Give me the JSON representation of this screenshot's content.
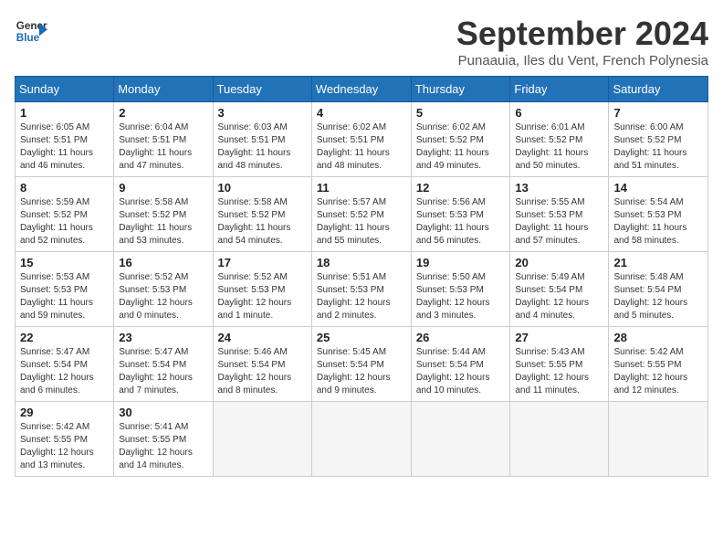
{
  "logo": {
    "line1": "General",
    "line2": "Blue"
  },
  "title": "September 2024",
  "subtitle": "Punaauia, Iles du Vent, French Polynesia",
  "days_of_week": [
    "Sunday",
    "Monday",
    "Tuesday",
    "Wednesday",
    "Thursday",
    "Friday",
    "Saturday"
  ],
  "weeks": [
    [
      {
        "day": "1",
        "detail": "Sunrise: 6:05 AM\nSunset: 5:51 PM\nDaylight: 11 hours\nand 46 minutes."
      },
      {
        "day": "2",
        "detail": "Sunrise: 6:04 AM\nSunset: 5:51 PM\nDaylight: 11 hours\nand 47 minutes."
      },
      {
        "day": "3",
        "detail": "Sunrise: 6:03 AM\nSunset: 5:51 PM\nDaylight: 11 hours\nand 48 minutes."
      },
      {
        "day": "4",
        "detail": "Sunrise: 6:02 AM\nSunset: 5:51 PM\nDaylight: 11 hours\nand 48 minutes."
      },
      {
        "day": "5",
        "detail": "Sunrise: 6:02 AM\nSunset: 5:52 PM\nDaylight: 11 hours\nand 49 minutes."
      },
      {
        "day": "6",
        "detail": "Sunrise: 6:01 AM\nSunset: 5:52 PM\nDaylight: 11 hours\nand 50 minutes."
      },
      {
        "day": "7",
        "detail": "Sunrise: 6:00 AM\nSunset: 5:52 PM\nDaylight: 11 hours\nand 51 minutes."
      }
    ],
    [
      {
        "day": "8",
        "detail": "Sunrise: 5:59 AM\nSunset: 5:52 PM\nDaylight: 11 hours\nand 52 minutes."
      },
      {
        "day": "9",
        "detail": "Sunrise: 5:58 AM\nSunset: 5:52 PM\nDaylight: 11 hours\nand 53 minutes."
      },
      {
        "day": "10",
        "detail": "Sunrise: 5:58 AM\nSunset: 5:52 PM\nDaylight: 11 hours\nand 54 minutes."
      },
      {
        "day": "11",
        "detail": "Sunrise: 5:57 AM\nSunset: 5:52 PM\nDaylight: 11 hours\nand 55 minutes."
      },
      {
        "day": "12",
        "detail": "Sunrise: 5:56 AM\nSunset: 5:53 PM\nDaylight: 11 hours\nand 56 minutes."
      },
      {
        "day": "13",
        "detail": "Sunrise: 5:55 AM\nSunset: 5:53 PM\nDaylight: 11 hours\nand 57 minutes."
      },
      {
        "day": "14",
        "detail": "Sunrise: 5:54 AM\nSunset: 5:53 PM\nDaylight: 11 hours\nand 58 minutes."
      }
    ],
    [
      {
        "day": "15",
        "detail": "Sunrise: 5:53 AM\nSunset: 5:53 PM\nDaylight: 11 hours\nand 59 minutes."
      },
      {
        "day": "16",
        "detail": "Sunrise: 5:52 AM\nSunset: 5:53 PM\nDaylight: 12 hours\nand 0 minutes."
      },
      {
        "day": "17",
        "detail": "Sunrise: 5:52 AM\nSunset: 5:53 PM\nDaylight: 12 hours\nand 1 minute."
      },
      {
        "day": "18",
        "detail": "Sunrise: 5:51 AM\nSunset: 5:53 PM\nDaylight: 12 hours\nand 2 minutes."
      },
      {
        "day": "19",
        "detail": "Sunrise: 5:50 AM\nSunset: 5:53 PM\nDaylight: 12 hours\nand 3 minutes."
      },
      {
        "day": "20",
        "detail": "Sunrise: 5:49 AM\nSunset: 5:54 PM\nDaylight: 12 hours\nand 4 minutes."
      },
      {
        "day": "21",
        "detail": "Sunrise: 5:48 AM\nSunset: 5:54 PM\nDaylight: 12 hours\nand 5 minutes."
      }
    ],
    [
      {
        "day": "22",
        "detail": "Sunrise: 5:47 AM\nSunset: 5:54 PM\nDaylight: 12 hours\nand 6 minutes."
      },
      {
        "day": "23",
        "detail": "Sunrise: 5:47 AM\nSunset: 5:54 PM\nDaylight: 12 hours\nand 7 minutes."
      },
      {
        "day": "24",
        "detail": "Sunrise: 5:46 AM\nSunset: 5:54 PM\nDaylight: 12 hours\nand 8 minutes."
      },
      {
        "day": "25",
        "detail": "Sunrise: 5:45 AM\nSunset: 5:54 PM\nDaylight: 12 hours\nand 9 minutes."
      },
      {
        "day": "26",
        "detail": "Sunrise: 5:44 AM\nSunset: 5:54 PM\nDaylight: 12 hours\nand 10 minutes."
      },
      {
        "day": "27",
        "detail": "Sunrise: 5:43 AM\nSunset: 5:55 PM\nDaylight: 12 hours\nand 11 minutes."
      },
      {
        "day": "28",
        "detail": "Sunrise: 5:42 AM\nSunset: 5:55 PM\nDaylight: 12 hours\nand 12 minutes."
      }
    ],
    [
      {
        "day": "29",
        "detail": "Sunrise: 5:42 AM\nSunset: 5:55 PM\nDaylight: 12 hours\nand 13 minutes."
      },
      {
        "day": "30",
        "detail": "Sunrise: 5:41 AM\nSunset: 5:55 PM\nDaylight: 12 hours\nand 14 minutes."
      },
      {
        "day": "",
        "detail": ""
      },
      {
        "day": "",
        "detail": ""
      },
      {
        "day": "",
        "detail": ""
      },
      {
        "day": "",
        "detail": ""
      },
      {
        "day": "",
        "detail": ""
      }
    ]
  ]
}
